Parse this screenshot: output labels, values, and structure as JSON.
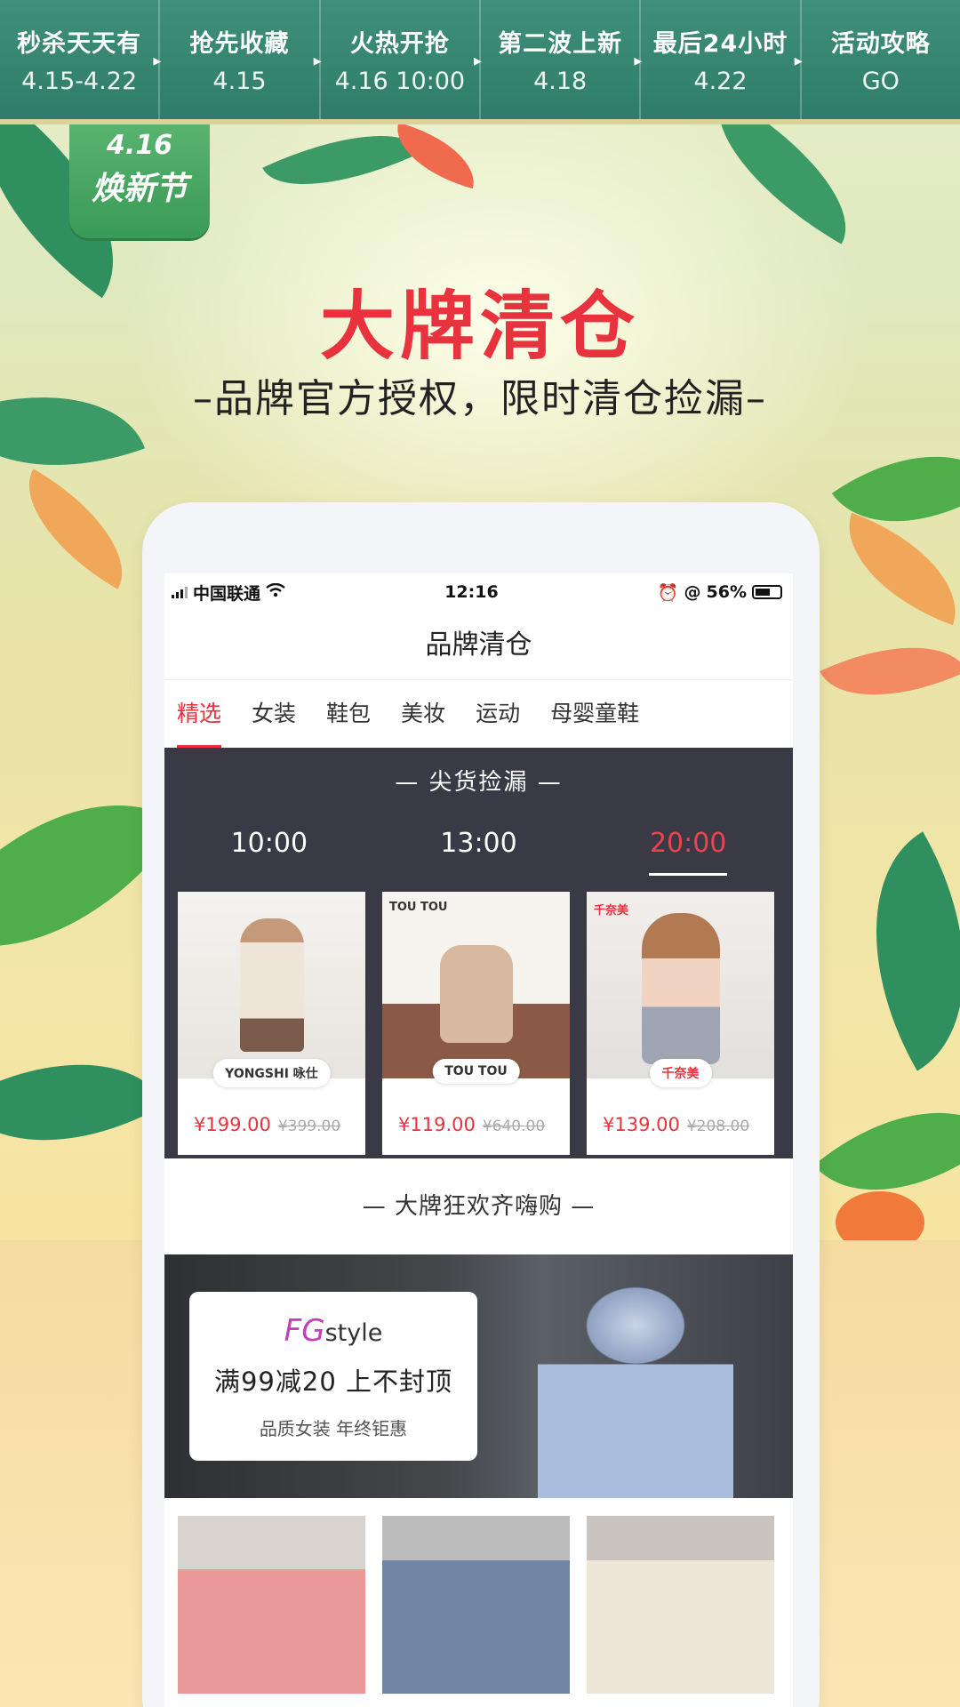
{
  "timeline": [
    {
      "name": "秒杀天天有",
      "date": "4.15-4.22"
    },
    {
      "name": "抢先收藏",
      "date": "4.15"
    },
    {
      "name": "火热开抢",
      "date": "4.16 10:00"
    },
    {
      "name": "第二波上新",
      "date": "4.18"
    },
    {
      "name": "最后24小时",
      "date": "4.22"
    },
    {
      "name": "活动攻略",
      "date": "GO"
    }
  ],
  "badge": {
    "date": "4.16",
    "name": "焕新节"
  },
  "hero": {
    "title": "大牌清仓",
    "subtitle": "–品牌官方授权，限时清仓捡漏–"
  },
  "status_bar": {
    "carrier": "中国联通",
    "time": "12:16",
    "battery": "56%"
  },
  "page": {
    "title": "品牌清仓"
  },
  "tabs": [
    "精选",
    "女装",
    "鞋包",
    "美妆",
    "运动",
    "母婴童鞋"
  ],
  "hot": {
    "title": "—  尖货捡漏  —",
    "times": [
      "10:00",
      "13:00",
      "20:00"
    ],
    "active_time": "20:00",
    "products": [
      {
        "brand": "YONGSHI 咏仕",
        "price": "¥199.00",
        "old_price": "¥399.00"
      },
      {
        "brand": "TOU TOU",
        "corner": "TOU TOU",
        "price": "¥119.00",
        "old_price": "¥640.00"
      },
      {
        "brand": "千奈美",
        "corner": "千奈美",
        "price": "¥139.00",
        "old_price": "¥208.00"
      }
    ]
  },
  "party": {
    "title": "—  大牌狂欢齐嗨购  —",
    "banner": {
      "brand": "style",
      "promo": "满99减20 上不封顶",
      "tagline": "品质女装 年终钜惠"
    }
  },
  "colors": {
    "accent": "#e8323e",
    "timeline_bg": "#2f7d69",
    "hot_bg": "#3a3a46"
  }
}
